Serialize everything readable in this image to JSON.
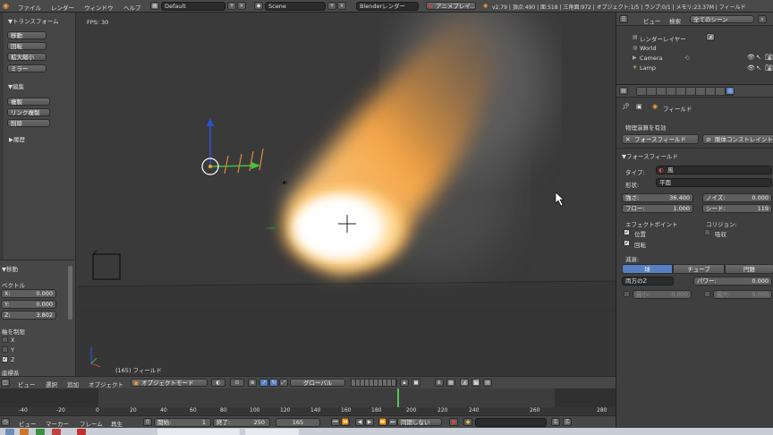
{
  "topbar": {
    "menus": [
      "ファイル",
      "レンダー",
      "ウィンドウ",
      "ヘルプ"
    ],
    "layout": "Default",
    "scene": "Scene",
    "engine": "Blenderレンダー",
    "anim_player": "アニメプレイ...",
    "stats": "v2.79 | 頂点:490 | 面:518 | 三角面:972 | オブジェクト:1/5 | ランプ:0/1 | メモリ:23.37M | フィールド"
  },
  "toolshelf": {
    "transform_header": "▼トランスフォーム",
    "transform_buttons": [
      "移動",
      "回転",
      "拡大縮小",
      "ミラー"
    ],
    "edit_header": "▼編集",
    "edit_buttons": [
      "複製",
      "リンク複製",
      "削除"
    ],
    "history_header": "▶履歴"
  },
  "operator_panel": {
    "title": "▼移動",
    "vector_label": "ベクトル",
    "vector": [
      {
        "axis": "X:",
        "value": "0.000"
      },
      {
        "axis": "Y:",
        "value": "0.000"
      },
      {
        "axis": "Z:",
        "value": "3.802"
      }
    ],
    "constraint_label": "軸を制限",
    "axes": [
      {
        "label": "X",
        "checked": false
      },
      {
        "label": "Y",
        "checked": false
      },
      {
        "label": "Z",
        "checked": true
      }
    ],
    "orientation_label": "座標系"
  },
  "viewport": {
    "fps": "FPS: 30",
    "object_label": "(165) フィールド"
  },
  "viewport_header": {
    "menus": [
      "ビュー",
      "選択",
      "追加",
      "オブジェクト"
    ],
    "mode": "オブジェクトモード",
    "orientation": "グローバル"
  },
  "timeline": {
    "ticks": [
      "-40",
      "-20",
      "0",
      "20",
      "40",
      "60",
      "80",
      "100",
      "120",
      "140",
      "160",
      "180",
      "200",
      "220",
      "240",
      "260",
      "280"
    ],
    "current_frame_marker": 165,
    "menus": [
      "ビュー",
      "マーカー",
      "フレーム",
      "再生"
    ],
    "start_label": "開始:",
    "start": "1",
    "end_label": "終了:",
    "end": "250",
    "current": "165",
    "sync": "同期しない"
  },
  "outliner": {
    "view_menu": "ビュー",
    "search_menu": "検索",
    "scene_filter": "全てのシーン",
    "items": [
      {
        "label": "レンダーレイヤー",
        "indent": 1
      },
      {
        "label": "World",
        "indent": 1
      },
      {
        "label": "Camera",
        "indent": 1
      },
      {
        "label": "Lamp",
        "indent": 1
      }
    ]
  },
  "properties": {
    "breadcrumb": "フィールド",
    "physics_toggle": "物理演算を有効",
    "force_field_button": "フォースフィールド",
    "rigid_constraint_button": "剛体コンストレイント",
    "section_header": "▼フォースフィールド",
    "type_label": "タイプ:",
    "type_value": "風",
    "shape_label": "形状:",
    "shape_value": "平面",
    "strength_label": "強さ:",
    "strength_value": "36.400",
    "noise_label": "ノイズ:",
    "noise_value": "0.000",
    "flow_label": "フロー:",
    "flow_value": "1.000",
    "seed_label": "シード:",
    "seed_value": "119",
    "effect_point_label": "エフェクトポイント",
    "location_label": "位置",
    "rotation_label": "回転",
    "collision_label": "コリジョン:",
    "absorb_label": "吸収",
    "falloff_label": "減衰:",
    "falloff_tabs": [
      "球",
      "チューブ",
      "円錐"
    ],
    "falloff_dir": "両方のZ",
    "power_label": "パワー:",
    "power_value": "0.000",
    "min_label": "最小:",
    "min_value": "0.000",
    "max_label": "最大:",
    "max_value": "0.000"
  }
}
